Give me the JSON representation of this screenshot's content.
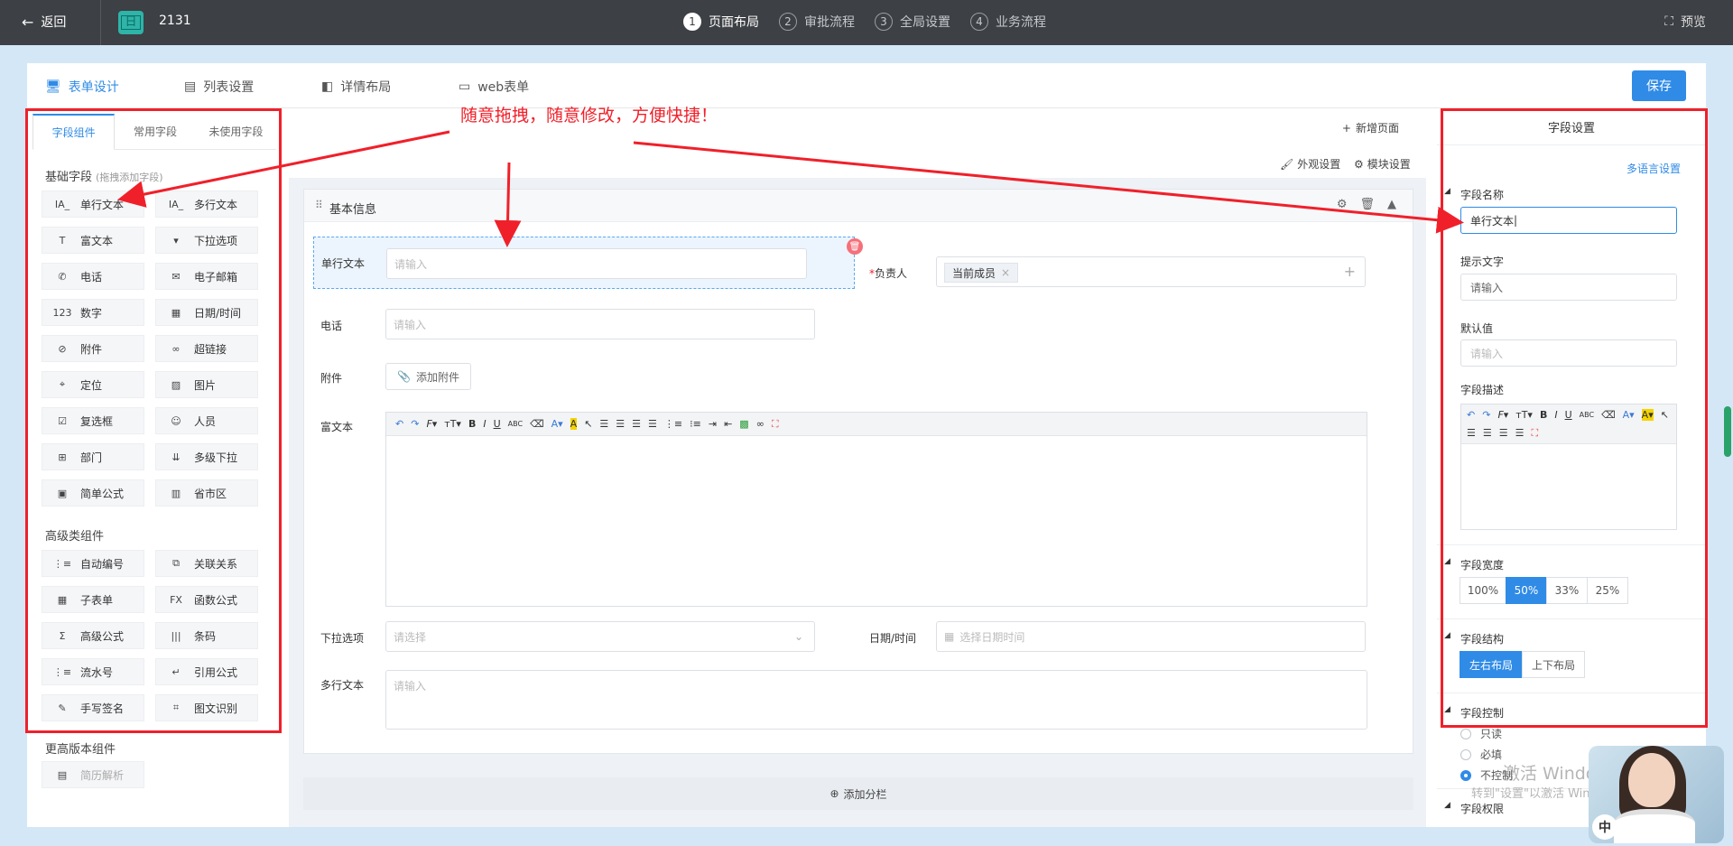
{
  "topbar": {
    "back_label": "返回",
    "app_icon_glyph": "日",
    "app_name": "2131",
    "steps": [
      {
        "num": "1",
        "label": "页面布局",
        "active": true
      },
      {
        "num": "2",
        "label": "审批流程",
        "active": false
      },
      {
        "num": "3",
        "label": "全局设置",
        "active": false
      },
      {
        "num": "4",
        "label": "业务流程",
        "active": false
      }
    ],
    "preview_label": "预览"
  },
  "page_tabs": [
    {
      "label": "表单设计",
      "icon": "monitor-icon",
      "active": true
    },
    {
      "label": "列表设置",
      "icon": "list-icon",
      "active": false
    },
    {
      "label": "详情布局",
      "icon": "layout-icon",
      "active": false
    },
    {
      "label": "web表单",
      "icon": "window-icon",
      "active": false
    }
  ],
  "save_label": "保存",
  "left_panel": {
    "tabs": [
      "字段组件",
      "常用字段",
      "未使用字段"
    ],
    "basic_title": "基础字段",
    "basic_hint": "(拖拽添加字段)",
    "basic_fields": [
      {
        "label": "单行文本",
        "glyph": "IA_"
      },
      {
        "label": "多行文本",
        "glyph": "IA_"
      },
      {
        "label": "富文本",
        "glyph": "T"
      },
      {
        "label": "下拉选项",
        "glyph": "▾"
      },
      {
        "label": "电话",
        "glyph": "✆"
      },
      {
        "label": "电子邮箱",
        "glyph": "✉"
      },
      {
        "label": "数字",
        "glyph": "123"
      },
      {
        "label": "日期/时间",
        "glyph": "▦"
      },
      {
        "label": "附件",
        "glyph": "⊘"
      },
      {
        "label": "超链接",
        "glyph": "∞"
      },
      {
        "label": "定位",
        "glyph": "⌖"
      },
      {
        "label": "图片",
        "glyph": "▨"
      },
      {
        "label": "复选框",
        "glyph": "☑"
      },
      {
        "label": "人员",
        "glyph": "☺"
      },
      {
        "label": "部门",
        "glyph": "⊞"
      },
      {
        "label": "多级下拉",
        "glyph": "⇊"
      },
      {
        "label": "简单公式",
        "glyph": "▣"
      },
      {
        "label": "省市区",
        "glyph": "▥"
      }
    ],
    "advanced_title": "高级类组件",
    "advanced_fields": [
      {
        "label": "自动编号",
        "glyph": "⋮≡"
      },
      {
        "label": "关联关系",
        "glyph": "⧉"
      },
      {
        "label": "子表单",
        "glyph": "▦"
      },
      {
        "label": "函数公式",
        "glyph": "FX"
      },
      {
        "label": "高级公式",
        "glyph": "Σ"
      },
      {
        "label": "条码",
        "glyph": "|||"
      },
      {
        "label": "流水号",
        "glyph": "⋮≡"
      },
      {
        "label": "引用公式",
        "glyph": "↵"
      },
      {
        "label": "手写签名",
        "glyph": "✎"
      },
      {
        "label": "图文识别",
        "glyph": "⌗"
      }
    ],
    "premium_title": "更高版本组件",
    "premium_fields": [
      {
        "label": "简历解析",
        "glyph": "▤"
      }
    ]
  },
  "canvas": {
    "add_page_label": "新增页面",
    "appearance_label": "外观设置",
    "module_label": "模块设置",
    "section_title": "基本信息",
    "fields": {
      "single_text": {
        "label": "单行文本",
        "placeholder": "请输入"
      },
      "owner": {
        "label": "负责人",
        "required_mark": "*",
        "tag": "当前成员"
      },
      "phone": {
        "label": "电话",
        "placeholder": "请输入"
      },
      "attachment": {
        "label": "附件",
        "button": "添加附件"
      },
      "rich_text": {
        "label": "富文本"
      },
      "dropdown": {
        "label": "下拉选项",
        "placeholder": "请选择"
      },
      "datetime": {
        "label": "日期/时间",
        "placeholder": "选择日期时间"
      },
      "multi_text": {
        "label": "多行文本",
        "placeholder": "请输入"
      }
    },
    "add_column_label": "添加分栏"
  },
  "right_panel": {
    "title": "字段设置",
    "multilang_link": "多语言设置",
    "name_label": "字段名称",
    "name_value": "单行文本",
    "hint_label": "提示文字",
    "hint_value": "请输入",
    "default_label": "默认值",
    "default_placeholder": "请输入",
    "desc_label": "字段描述",
    "width_label": "字段宽度",
    "width_options": [
      "100%",
      "50%",
      "33%",
      "25%"
    ],
    "width_selected": "50%",
    "structure_label": "字段结构",
    "structure_options": [
      "左右布局",
      "上下布局"
    ],
    "structure_selected": "左右布局",
    "control_label": "字段控制",
    "control_options": [
      "只读",
      "必填",
      "不控制"
    ],
    "control_selected": "不控制",
    "permission_label": "字段权限"
  },
  "annotation": {
    "text": "随意拖拽，随意修改，方便快捷！",
    "color": "#f0202a"
  },
  "watermark": {
    "line1": "激活 Windows",
    "line2": "转到\"设置\"以激活 Windows。"
  },
  "avatar_badge": "中"
}
